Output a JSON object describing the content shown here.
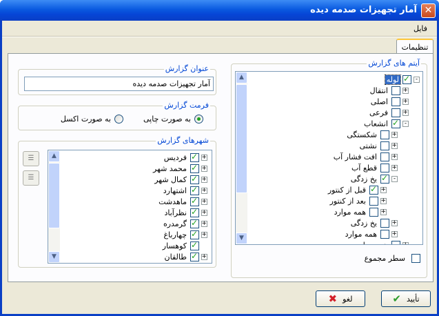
{
  "window": {
    "title": "آمار تجهيزات صدمه ديده",
    "close_icon": "close-icon"
  },
  "menu": {
    "file": "فايل"
  },
  "tabs": {
    "settings": "تنظيمات"
  },
  "report_title_group": {
    "label": "عنوان گزارش",
    "value": "آمار تجهيزات صدمه ديده"
  },
  "format_group": {
    "label": "فرمت گزارش",
    "options": [
      {
        "label": "به صورت چاپی",
        "checked": true
      },
      {
        "label": "به صورت اکسل",
        "checked": false
      }
    ]
  },
  "cities_group": {
    "label": "شهرهای گزارش",
    "items": [
      {
        "label": "فرديس",
        "checked": true,
        "expander": "+"
      },
      {
        "label": "محمد شهر",
        "checked": true,
        "expander": "+"
      },
      {
        "label": "کمال شهر",
        "checked": true,
        "expander": "+"
      },
      {
        "label": "اشتهارد",
        "checked": true,
        "expander": "+"
      },
      {
        "label": "ماهدشت",
        "checked": true,
        "expander": "+"
      },
      {
        "label": "نظرآباد",
        "checked": true,
        "expander": "+"
      },
      {
        "label": "گرمدره",
        "checked": true,
        "expander": "+"
      },
      {
        "label": "چهارباغ",
        "checked": true,
        "expander": "+"
      },
      {
        "label": "کوهسار",
        "checked": true,
        "expander": ""
      },
      {
        "label": "طالقان",
        "checked": true,
        "expander": "+"
      }
    ]
  },
  "items_group": {
    "label": "آيتم های گزارش",
    "tree": [
      {
        "label": "لوله",
        "checked": true,
        "expander": "-",
        "level": 0,
        "selected": true
      },
      {
        "label": "انتقال",
        "checked": false,
        "expander": "+",
        "level": 1
      },
      {
        "label": "اصلی",
        "checked": false,
        "expander": "+",
        "level": 1
      },
      {
        "label": "فرعی",
        "checked": false,
        "expander": "+",
        "level": 1
      },
      {
        "label": "انشعاب",
        "checked": true,
        "expander": "-",
        "level": 1
      },
      {
        "label": "شکستگی",
        "checked": false,
        "expander": "+",
        "level": 2
      },
      {
        "label": "نشتی",
        "checked": false,
        "expander": "+",
        "level": 2
      },
      {
        "label": "افت فشار آب",
        "checked": false,
        "expander": "+",
        "level": 2
      },
      {
        "label": "قطع آب",
        "checked": false,
        "expander": "+",
        "level": 2
      },
      {
        "label": "يخ زدگی",
        "checked": true,
        "expander": "-",
        "level": 2
      },
      {
        "label": "قبل از کنتور",
        "checked": true,
        "expander": "+",
        "level": 3
      },
      {
        "label": "بعد از کنتور",
        "checked": false,
        "expander": "+",
        "level": 3
      },
      {
        "label": "همه موارد",
        "checked": false,
        "expander": "+",
        "level": 3
      },
      {
        "label": "يخ زدگی",
        "checked": false,
        "expander": "+",
        "level": 2
      },
      {
        "label": "همه موارد",
        "checked": false,
        "expander": "+",
        "level": 2
      },
      {
        "label": "همه موارد",
        "checked": false,
        "expander": "+",
        "level": 1
      }
    ]
  },
  "total_row": {
    "label": "سطر مجموع",
    "checked": false
  },
  "buttons": {
    "ok": "تأييد",
    "cancel": "لغو"
  }
}
